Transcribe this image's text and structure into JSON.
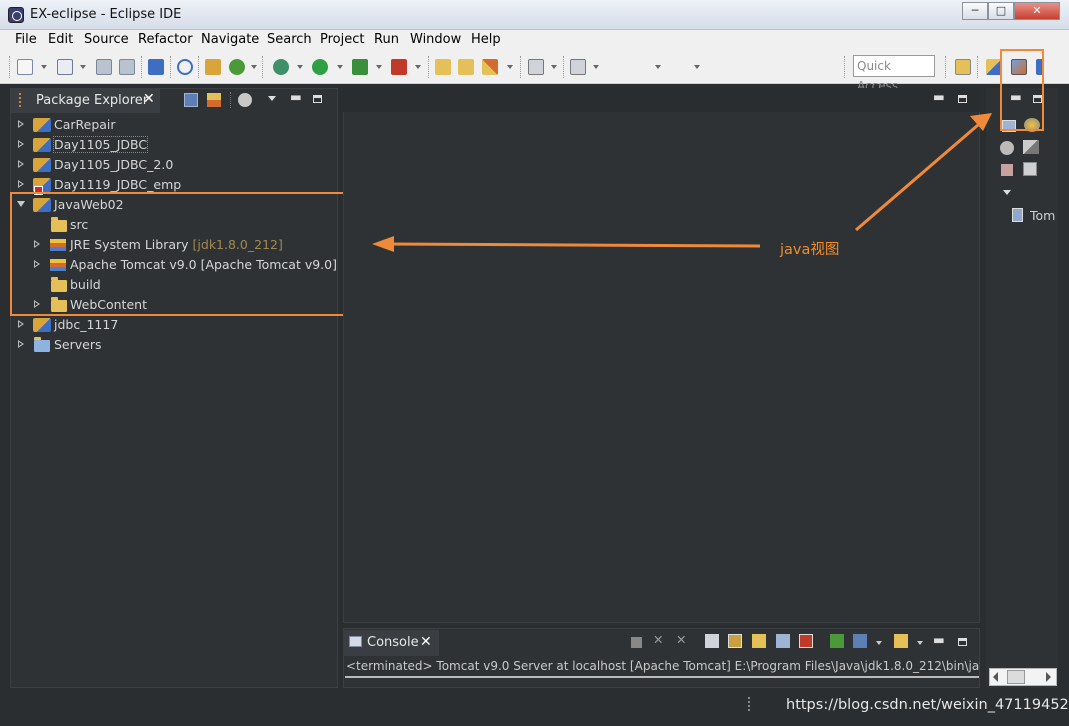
{
  "window": {
    "title": "EX-eclipse - Eclipse IDE",
    "min_label": "─",
    "max_label": "□",
    "close_label": "✕"
  },
  "menu": [
    "File",
    "Edit",
    "Source",
    "Refactor",
    "Navigate",
    "Search",
    "Project",
    "Run",
    "Window",
    "Help"
  ],
  "toolbar": {
    "quick_access_placeholder": "Quick Access"
  },
  "package_explorer": {
    "title": "Package Explorer",
    "close_label": "✕",
    "items": [
      {
        "label": "CarRepair",
        "expanded": false,
        "icon": "java-project-icon"
      },
      {
        "label": "Day1105_JDBC",
        "expanded": false,
        "icon": "java-project-icon"
      },
      {
        "label": "Day1105_JDBC_2.0",
        "expanded": false,
        "icon": "java-project-icon"
      },
      {
        "label": "Day1119_JDBC_emp",
        "expanded": false,
        "icon": "java-project-error-icon"
      },
      {
        "label": "JavaWeb02",
        "expanded": true,
        "icon": "web-project-icon",
        "children": [
          {
            "label": "src",
            "icon": "source-folder-icon",
            "expandable": false
          },
          {
            "label": "JRE System Library",
            "annotation": "[jdk1.8.0_212]",
            "icon": "library-icon",
            "expandable": true
          },
          {
            "label": "Apache Tomcat v9.0 [Apache Tomcat v9.0]",
            "icon": "library-icon",
            "expandable": true
          },
          {
            "label": "build",
            "icon": "folder-icon",
            "expandable": false
          },
          {
            "label": "WebContent",
            "icon": "folder-icon",
            "expandable": true
          }
        ]
      },
      {
        "label": "jdbc_1117",
        "expanded": false,
        "icon": "java-project-icon"
      },
      {
        "label": "Servers",
        "expanded": false,
        "icon": "folder-icon"
      }
    ]
  },
  "right_panel": {
    "server_label": "Tom"
  },
  "console": {
    "title": "Console",
    "close_label": "✕",
    "text": "<terminated> Tomcat v9.0 Server at localhost [Apache Tomcat] E:\\Program Files\\Java\\jdk1.8.0_212\\bin\\javaw"
  },
  "annotation": {
    "label": "java视图",
    "color": "#f08a3a"
  },
  "watermark": "https://blog.csdn.net/weixin_47119452"
}
